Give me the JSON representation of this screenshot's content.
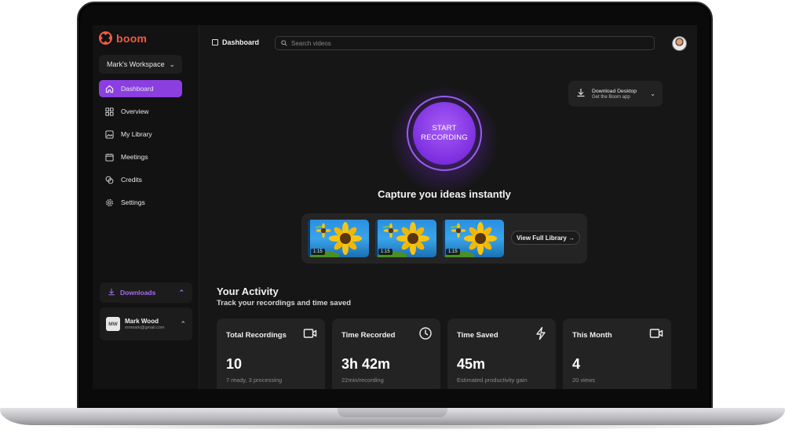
{
  "app": {
    "logo_text": "boom",
    "brand_color": "#f25a43",
    "accent_color": "#8b3fe0"
  },
  "sidebar": {
    "workspace": "Mark's Workspace",
    "items": [
      {
        "label": "Dashboard",
        "icon": "home-icon",
        "active": true
      },
      {
        "label": "Overview",
        "icon": "grid-icon",
        "active": false
      },
      {
        "label": "My Library",
        "icon": "image-icon",
        "active": false
      },
      {
        "label": "Meetings",
        "icon": "calendar-icon",
        "active": false
      },
      {
        "label": "Credits",
        "icon": "coins-icon",
        "active": false
      },
      {
        "label": "Settings",
        "icon": "gear-icon",
        "active": false
      }
    ],
    "downloads_label": "Downloads",
    "user": {
      "initials": "MW",
      "name": "Mark Wood",
      "email": "mnmark@gmail.com"
    }
  },
  "header": {
    "breadcrumb": "Dashboard",
    "search_placeholder": "Search videos"
  },
  "download_desktop": {
    "title": "Download Desktop",
    "subtitle": "Get the Boom app"
  },
  "record": {
    "line1": "START",
    "line2": "RECORDING"
  },
  "tagline": "Capture you ideas instantly",
  "recent": {
    "thumbnails": [
      {
        "duration": "1:15"
      },
      {
        "duration": "1:15"
      },
      {
        "duration": "1:15"
      }
    ],
    "view_all_label": "View Full Library →"
  },
  "activity": {
    "title": "Your Activity",
    "subtitle": "Track your recordings and time saved",
    "stats": [
      {
        "label": "Total Recordings",
        "value": "10",
        "note": "7 ready, 3 processing",
        "icon": "video-camera-icon"
      },
      {
        "label": "Time Recorded",
        "value": "3h 42m",
        "note": "22min/recording",
        "icon": "clock-icon"
      },
      {
        "label": "Time Saved",
        "value": "45m",
        "note": "Estimated productivity gain",
        "icon": "lightning-icon"
      },
      {
        "label": "This Month",
        "value": "4",
        "note": "20 views",
        "icon": "video-camera-icon"
      }
    ]
  }
}
